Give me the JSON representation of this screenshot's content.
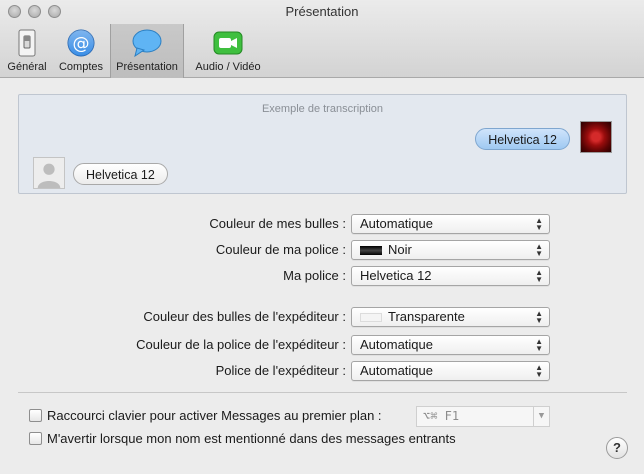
{
  "window": {
    "title": "Présentation"
  },
  "toolbar": {
    "general": "Général",
    "comptes": "Comptes",
    "presentation": "Présentation",
    "audio_video": "Audio / Vidéo"
  },
  "preview": {
    "title": "Exemple de transcription",
    "my_bubble": "Helvetica 12",
    "their_bubble": "Helvetica 12"
  },
  "settings": {
    "my_bubble_color_label": "Couleur de mes bulles :",
    "my_bubble_color_value": "Automatique",
    "my_font_color_label": "Couleur de ma police :",
    "my_font_color_value": "Noir",
    "my_font_label": "Ma police :",
    "my_font_value": "Helvetica 12",
    "sender_bubble_color_label": "Couleur des bulles de l'expéditeur :",
    "sender_bubble_color_value": "Transparente",
    "sender_font_color_label": "Couleur de la police de l'expéditeur :",
    "sender_font_color_value": "Automatique",
    "sender_font_label": "Police de l'expéditeur :",
    "sender_font_value": "Automatique"
  },
  "options": {
    "shortcut_label": "Raccourci clavier pour activer Messages au premier plan :",
    "shortcut_value": "⌥⌘ F1",
    "mention_label": "M'avertir lorsque mon nom est mentionné dans des messages entrants"
  },
  "help": {
    "label": "?"
  },
  "colors": {
    "accent_blue": "#9fc9f2",
    "font_black": "#000000"
  }
}
